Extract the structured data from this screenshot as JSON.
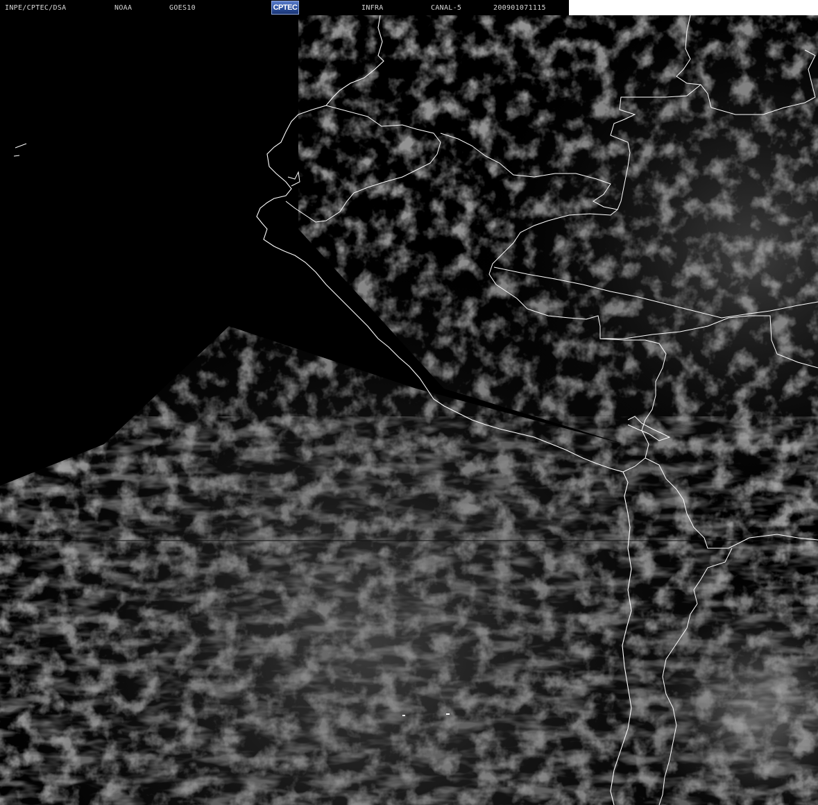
{
  "header": {
    "institution": "INPE/CPTEC/DSA",
    "agency": "NOAA",
    "satellite": "GOES10",
    "logo_text": "CPTEC",
    "product": "INFRA",
    "channel": "CANAL-5",
    "timestamp": "200901071115"
  },
  "colors": {
    "background": "#000000",
    "boundaries": "#ffffff",
    "clouds": "#7a7a7a"
  }
}
